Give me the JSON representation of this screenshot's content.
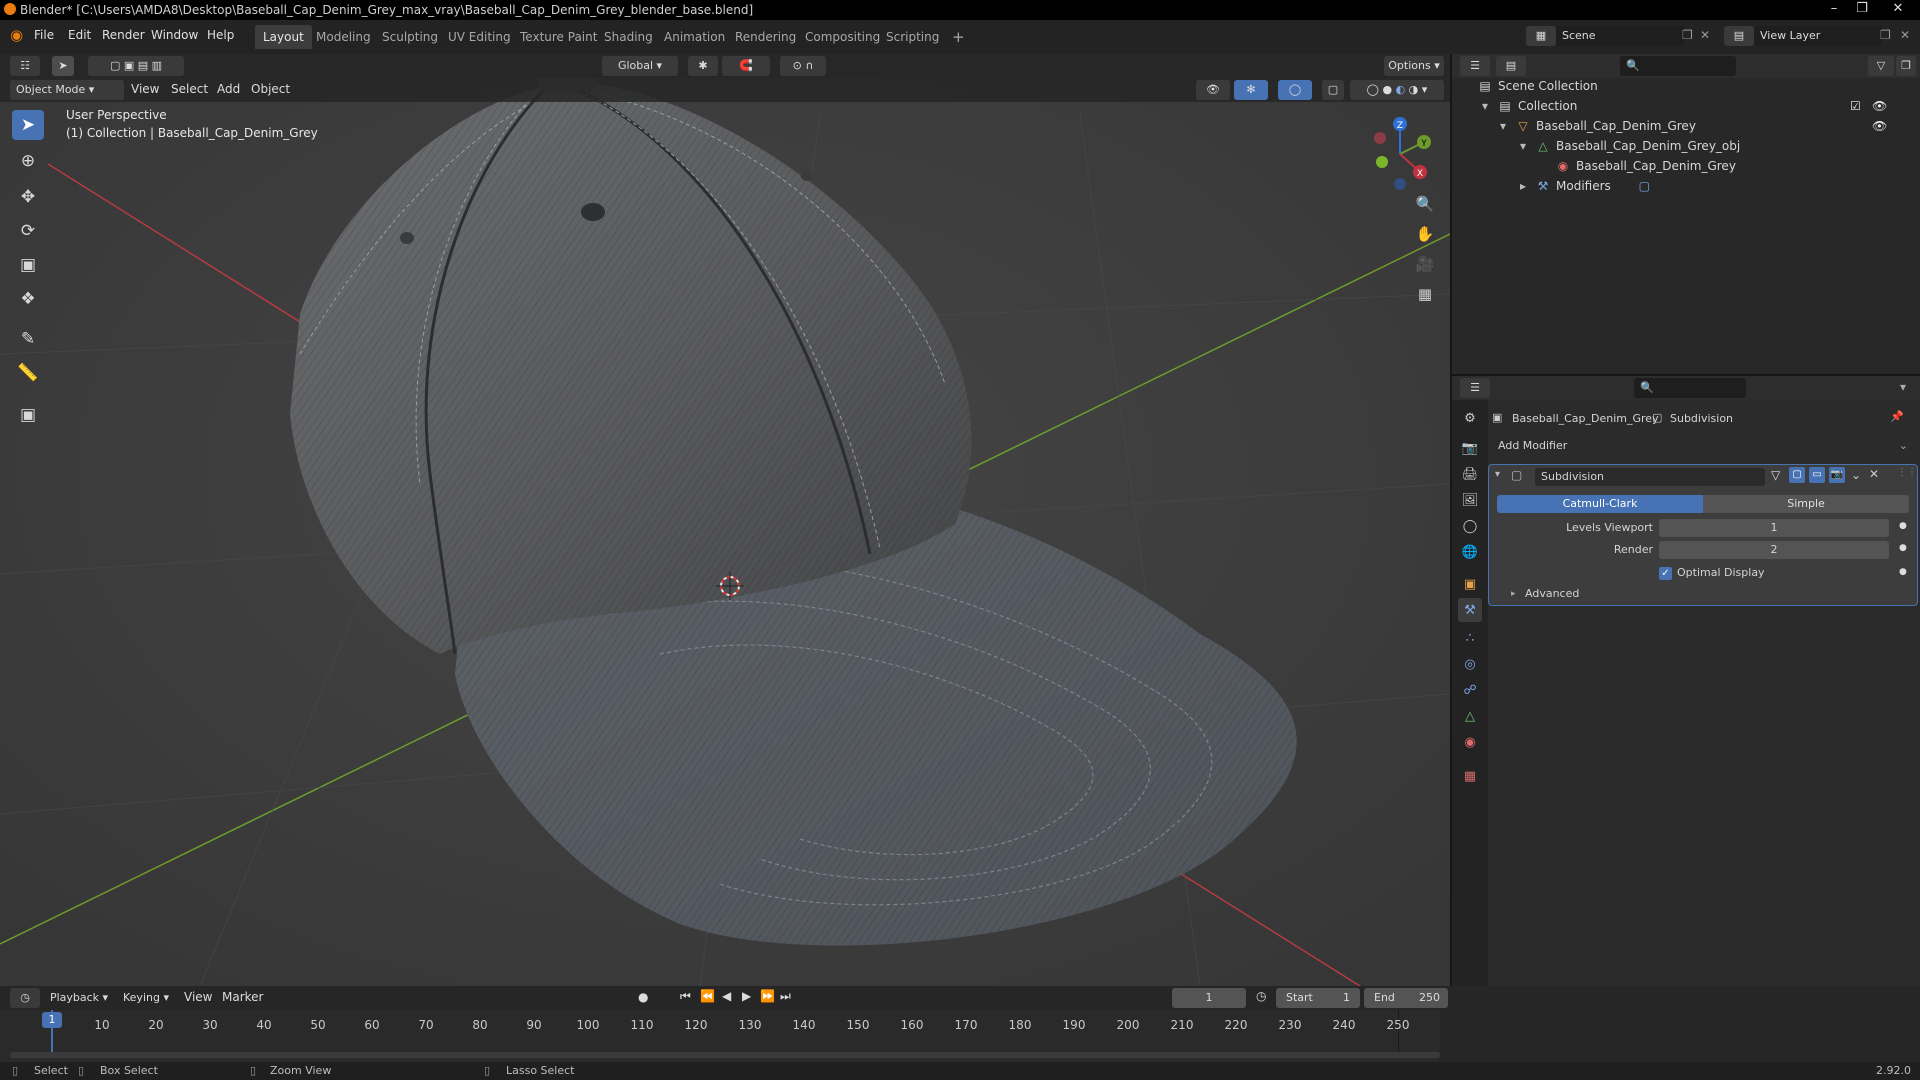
{
  "window": {
    "title": "Blender* [C:\\Users\\AMDA8\\Desktop\\Baseball_Cap_Denim_Grey_max_vray\\Baseball_Cap_Denim_Grey_blender_base.blend]"
  },
  "menu": {
    "file": "File",
    "edit": "Edit",
    "render": "Render",
    "window": "Window",
    "help": "Help"
  },
  "workspaces": [
    "Layout",
    "Modeling",
    "Sculpting",
    "UV Editing",
    "Texture Paint",
    "Shading",
    "Animation",
    "Rendering",
    "Compositing",
    "Scripting"
  ],
  "active_workspace": "Layout",
  "scene": {
    "name": "Scene",
    "view_layer": "View Layer"
  },
  "viewport": {
    "transform_orientation": "Global",
    "options_label": "Options",
    "mode": "Object Mode",
    "menus": [
      "View",
      "Select",
      "Add",
      "Object"
    ],
    "overlay_title": "User Perspective",
    "overlay_subtitle": "(1) Collection | Baseball_Cap_Denim_Grey",
    "gizmo_axes": {
      "z": "Z",
      "y": "Y",
      "x": "X"
    }
  },
  "outliner": {
    "rows": [
      {
        "label": "Scene Collection",
        "icon": "collection-icon"
      },
      {
        "label": "Collection",
        "icon": "collection-icon"
      },
      {
        "label": "Baseball_Cap_Denim_Grey",
        "icon": "empty-object-icon"
      },
      {
        "label": "Baseball_Cap_Denim_Grey_obj",
        "icon": "mesh-data-icon"
      },
      {
        "label": "Baseball_Cap_Denim_Grey",
        "icon": "material-icon"
      },
      {
        "label": "Modifiers",
        "icon": "wrench-icon"
      }
    ]
  },
  "properties": {
    "breadcrumb_object": "Baseball_Cap_Denim_Grey",
    "breadcrumb_modifier": "Subdivision",
    "add_modifier": "Add Modifier",
    "modifier_name": "Subdivision",
    "method_catmull": "Catmull-Clark",
    "method_simple": "Simple",
    "levels_viewport_label": "Levels Viewport",
    "levels_viewport_value": "1",
    "render_label": "Render",
    "render_value": "2",
    "optimal_display_label": "Optimal Display",
    "optimal_display_checked": true,
    "advanced_label": "Advanced"
  },
  "timeline": {
    "menus": [
      "Playback",
      "Keying",
      "View",
      "Marker"
    ],
    "current_frame": "1",
    "start_label": "Start",
    "start_value": "1",
    "end_label": "End",
    "end_value": "250",
    "ruler": [
      "10",
      "20",
      "30",
      "40",
      "50",
      "60",
      "70",
      "80",
      "90",
      "100",
      "110",
      "120",
      "130",
      "140",
      "150",
      "160",
      "170",
      "180",
      "190",
      "200",
      "210",
      "220",
      "230",
      "240",
      "250"
    ],
    "playhead_label": "1"
  },
  "status": {
    "select": "Select",
    "box_select": "Box Select",
    "zoom_view": "Zoom View",
    "lasso_select": "Lasso Select",
    "version": "2.92.0"
  },
  "colors": {
    "accent": "#4772b3",
    "viewport_bg": "#3c3c3c",
    "x_axis": "#c0333f",
    "y_axis": "#6e9b2c"
  }
}
